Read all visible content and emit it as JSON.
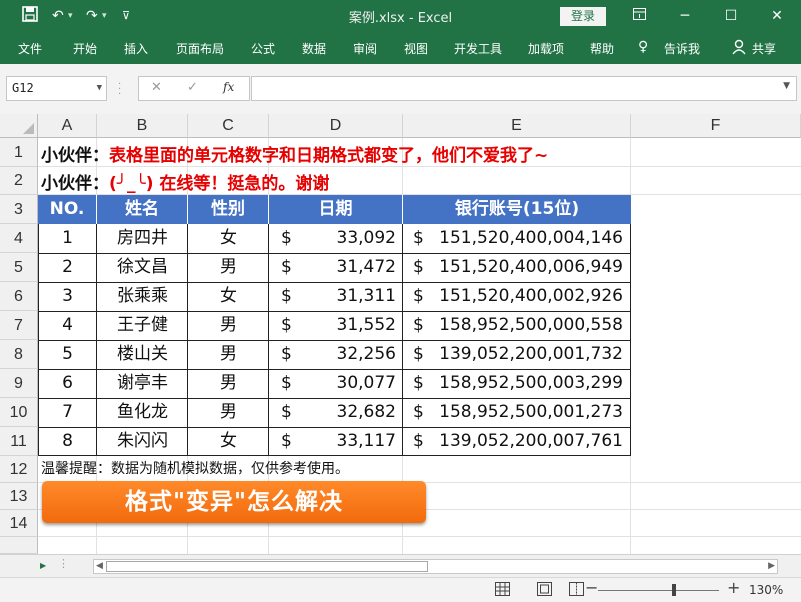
{
  "titlebar": {
    "doc_title": "案例.xlsx  -  Excel",
    "login": "登录",
    "save_icon": "save-icon",
    "undo_icon": "undo-icon",
    "redo_icon": "redo-icon"
  },
  "ribbon": {
    "tabs": [
      "文件",
      "开始",
      "插入",
      "页面布局",
      "公式",
      "数据",
      "审阅",
      "视图",
      "开发工具",
      "加载项",
      "帮助"
    ],
    "tell_me": "告诉我",
    "share": "共享"
  },
  "formula": {
    "name_box": "G12",
    "fx": "fx",
    "value": ""
  },
  "columns": [
    "A",
    "B",
    "C",
    "D",
    "E",
    "F"
  ],
  "rows": [
    "1",
    "2",
    "3",
    "4",
    "5",
    "6",
    "7",
    "8",
    "9",
    "10",
    "11",
    "12",
    "13",
    "14"
  ],
  "notes": {
    "line1_label": "小伙伴：",
    "line1_text": "表格里面的单元格数字和日期格式都变了，他们不爱我了~",
    "line2_label": "小伙伴：",
    "line2_text": "(╯_╰) 在线等！挺急的。谢谢"
  },
  "table": {
    "headers": [
      "NO.",
      "姓名",
      "性别",
      "日期",
      "银行账号(15位)"
    ],
    "currency": "$",
    "rows": [
      {
        "no": "1",
        "name": "房四井",
        "gender": "女",
        "date": "33,092",
        "account": "151,520,400,004,146"
      },
      {
        "no": "2",
        "name": "徐文昌",
        "gender": "男",
        "date": "31,472",
        "account": "151,520,400,006,949"
      },
      {
        "no": "3",
        "name": "张乘乘",
        "gender": "女",
        "date": "31,311",
        "account": "151,520,400,002,926"
      },
      {
        "no": "4",
        "name": "王子健",
        "gender": "男",
        "date": "31,552",
        "account": "158,952,500,000,558"
      },
      {
        "no": "5",
        "name": "楼山关",
        "gender": "男",
        "date": "32,256",
        "account": "139,052,200,001,732"
      },
      {
        "no": "6",
        "name": "谢亭丰",
        "gender": "男",
        "date": "30,077",
        "account": "158,952,500,003,299"
      },
      {
        "no": "7",
        "name": "鱼化龙",
        "gender": "男",
        "date": "32,682",
        "account": "158,952,500,001,273"
      },
      {
        "no": "8",
        "name": "朱闪闪",
        "gender": "女",
        "date": "33,117",
        "account": "139,052,200,007,761"
      }
    ]
  },
  "tip": "温馨提醒：数据为随机模拟数据，仅供参考使用。",
  "banner": "格式\"变异\"怎么解决",
  "statusbar": {
    "zoom_level": "130%",
    "zoom_fraction": 0.63
  }
}
